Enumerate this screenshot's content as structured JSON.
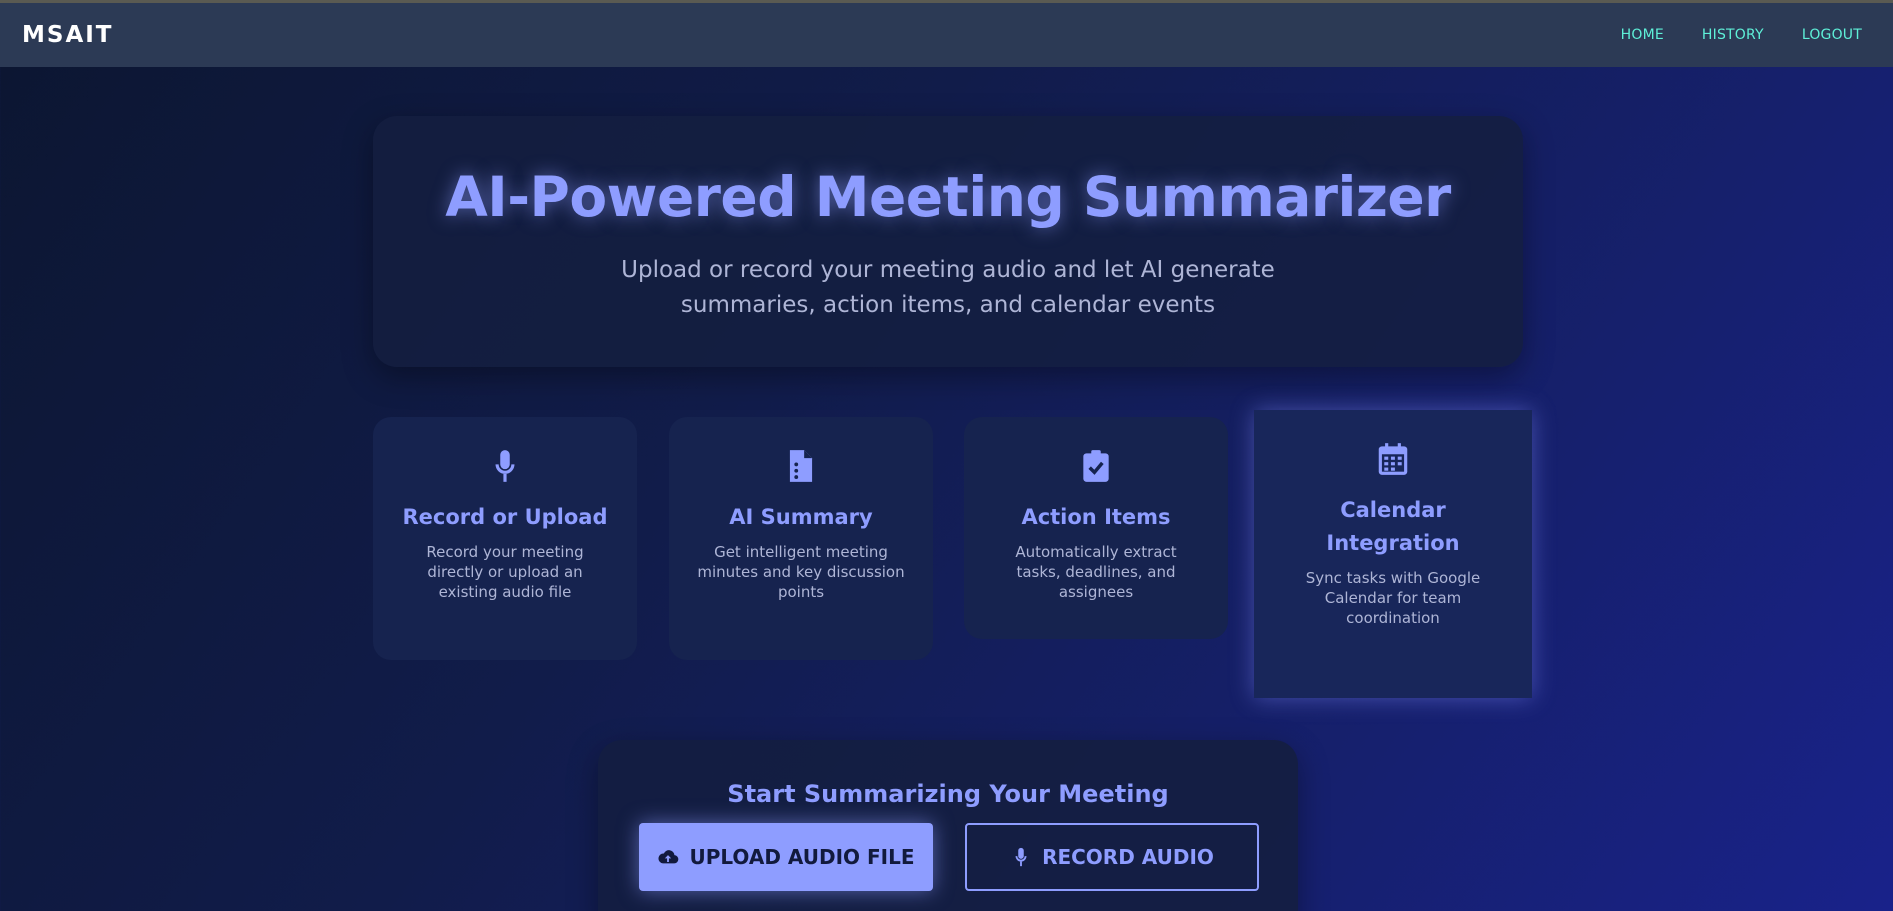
{
  "navbar": {
    "brand": "MSAIT",
    "links": [
      "HOME",
      "HISTORY",
      "LOGOUT"
    ]
  },
  "hero": {
    "title": "AI-Powered Meeting Summarizer",
    "subtitle": "Upload or record your meeting audio and let AI generate summaries, action items, and calendar events"
  },
  "features": [
    {
      "icon": "microphone-icon",
      "title": "Record or Upload",
      "description": "Record your meeting directly or upload an existing audio file"
    },
    {
      "icon": "document-icon",
      "title": "AI Summary",
      "description": "Get intelligent meeting minutes and key discussion points"
    },
    {
      "icon": "clipboard-check-icon",
      "title": "Action Items",
      "description": "Automatically extract tasks, deadlines, and assignees"
    },
    {
      "icon": "calendar-icon",
      "title": "Calendar Integration",
      "description": "Sync tasks with Google Calendar for team coordination"
    }
  ],
  "cta": {
    "title": "Start Summarizing Your Meeting",
    "upload_label": "UPLOAD AUDIO FILE",
    "record_label": "RECORD AUDIO"
  },
  "colors": {
    "accent": "#8e9dff",
    "nav_link": "#5ef0d8",
    "navbar_bg": "#2c3a55"
  }
}
